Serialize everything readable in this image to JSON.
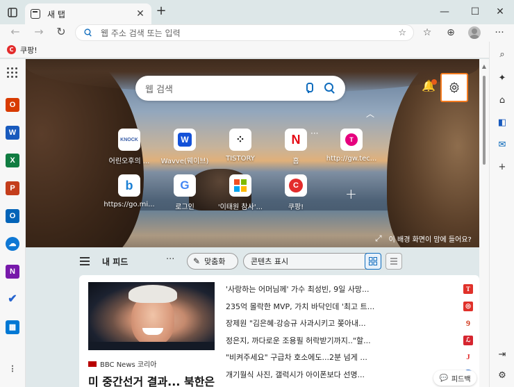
{
  "tab": {
    "title": "새 탭",
    "close": "✕",
    "new": "+"
  },
  "window": {
    "minimize": "—",
    "maximize": "☐",
    "close": "✕"
  },
  "address": {
    "placeholder": "웹 주소 검색 또는 입력"
  },
  "favorites": [
    {
      "label": "쿠팡!",
      "icon": "C"
    }
  ],
  "search": {
    "placeholder": "웹 검색"
  },
  "quick_links": [
    {
      "label": "어린오후의 ...",
      "icon": "KNOCK",
      "color": "#3b5fa8"
    },
    {
      "label": "Wavve(웨이브)",
      "icon": "W",
      "color": "#1351d8"
    },
    {
      "label": "TISTORY",
      "icon": "⁘",
      "color": "#222222"
    },
    {
      "label": "홈",
      "icon": "N",
      "color": "#e50914"
    },
    {
      "label": "http://gw.tec...",
      "icon": "T",
      "color": "#e6007e"
    },
    {
      "label": "https://go.mi...",
      "icon": "b",
      "color": "#1a7fd4"
    },
    {
      "label": "로그인",
      "icon": "G",
      "color": "#4285f4"
    },
    {
      "label": "'이태원 참사'...",
      "icon": "⊞",
      "color": "#f25022"
    },
    {
      "label": "쿠팡!",
      "icon": "C",
      "color": "#e32c2c"
    }
  ],
  "background_info": "이 배경 화면이 맘에 들어요?",
  "feed": {
    "title": "내 피드",
    "more": "···",
    "personalize": "맞춤화",
    "content_select": "콘텐츠 표시"
  },
  "article": {
    "source": "BBC News 코리아",
    "headline": "미 중간선거 결과... 북한은"
  },
  "news": [
    {
      "title": "'사랑하는 어머님께' 가수 최성빈, 9일 사망...",
      "icon": "T",
      "color": "#e0312a"
    },
    {
      "title": "235억 몰락한 MVP, 가치 바닥인데 '최고 트...",
      "icon": "◎",
      "color": "#e0312a"
    },
    {
      "title": "장제원 \"김은혜·강승규 사과시키고 쫒아내...",
      "icon": "9",
      "color": "#d13b1f"
    },
    {
      "title": "정은지, 까다로운 조용필 허락받기까지..\"할...",
      "icon": "ℒ",
      "color": "#d6252f"
    },
    {
      "title": "\"비켜주세요\" 구급차 호소에도...2분 넘게 ...",
      "icon": "J",
      "color": "#e22d2d"
    },
    {
      "title": "개기월식 사진, 갤럭시가 아이폰보다 선명...",
      "icon": "◆",
      "color": "#1e64c8"
    }
  ],
  "feedback": "피드백"
}
